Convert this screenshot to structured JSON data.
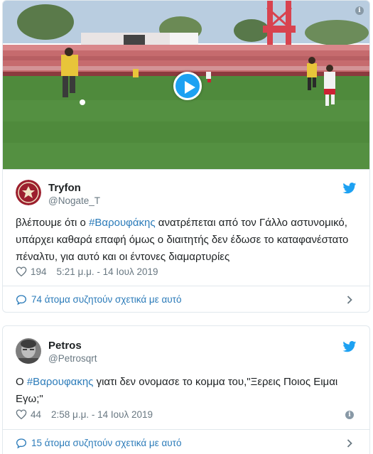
{
  "tweet1": {
    "name": "Tryfon",
    "handle": "@Nogate_T",
    "text_before": "βλέπουμε ότι ο ",
    "hashtag": "#Βαρουφάκης",
    "text_after": " ανατρέπεται από τον Γάλλο αστυνομικό, υπάρχει καθαρά επαφή όμως ο διαιτητής δεν έδωσε το καταφανέστατο πέναλτυ, για αυτό και οι έντονες διαμαρτυρίες",
    "likes": "194",
    "timestamp": "5:21 μ.μ. - 14 Ιουλ 2019",
    "discussion": "74 άτομα συζητούν σχετικά με αυτό",
    "media_icon": "play-icon",
    "brand_color": "#1da1f2"
  },
  "tweet2": {
    "name": "Petros",
    "handle": "@Petrosqrt",
    "text_before": "Ο ",
    "hashtag": "#Βαρουφακης",
    "text_after": " γιατι δεν ονομασε το κομμα  του,\"Ξερεις Ποιος Ειμαι Εγω;\"",
    "likes": "44",
    "timestamp": "2:58 μ.μ. - 14 Ιουλ 2019",
    "discussion": "15 άτομα συζητούν σχετικά με αυτό"
  },
  "colors": {
    "link": "#2b7bb9",
    "meta": "#697882",
    "border": "#e1e8ed",
    "pitch": "#4f8a3c"
  }
}
